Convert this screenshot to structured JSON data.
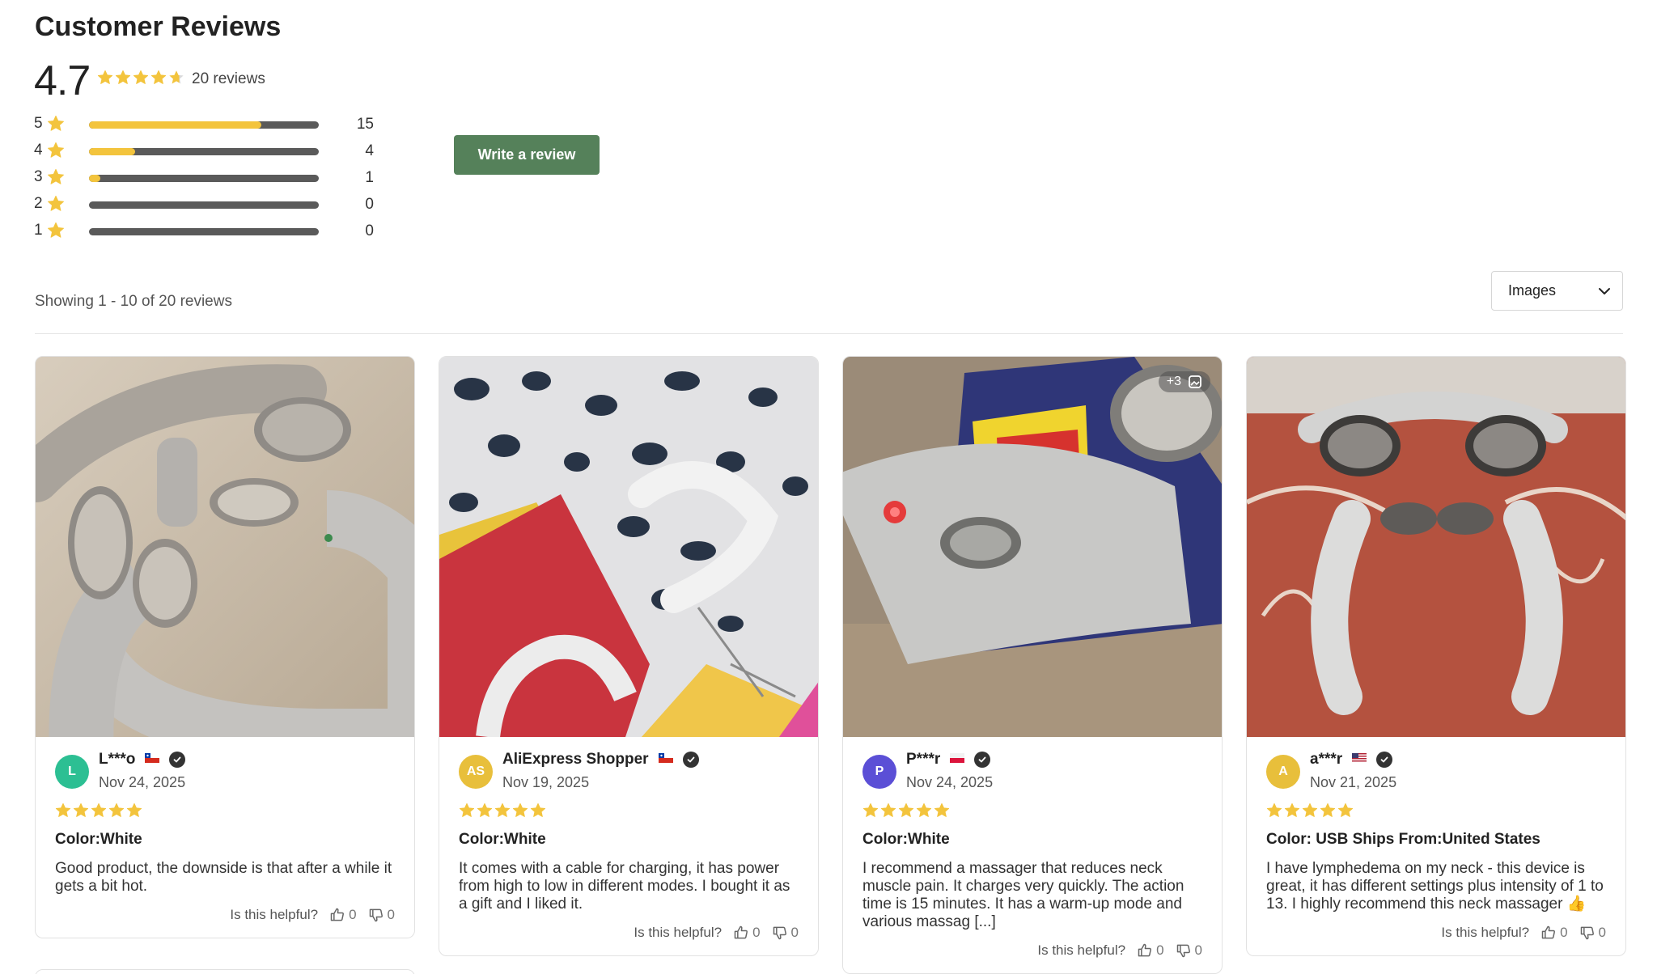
{
  "header": {
    "title": "Customer Reviews",
    "average": "4.7",
    "average_rating": 4.7,
    "total_label": "20 reviews"
  },
  "distribution": [
    {
      "level": "5",
      "count": "15",
      "fraction": 0.75
    },
    {
      "level": "4",
      "count": "4",
      "fraction": 0.2
    },
    {
      "level": "3",
      "count": "1",
      "fraction": 0.05
    },
    {
      "level": "2",
      "count": "0",
      "fraction": 0
    },
    {
      "level": "1",
      "count": "0",
      "fraction": 0
    }
  ],
  "write_review_label": "Write a review",
  "showing_label": "Showing 1 - 10 of 20 reviews",
  "filter": {
    "selected": "Images"
  },
  "colors": {
    "star": "#f3c43d",
    "button": "#55815a",
    "bar_track": "#5a5a5a"
  },
  "reviews": [
    {
      "initials": "L",
      "avatar_color": "#2cbf93",
      "name": "L***o",
      "flag": "Chile",
      "date": "Nov 24, 2025",
      "rating": 5,
      "variant": "Color:White",
      "text": "Good product, the downside is that after a while it gets a bit hot.",
      "helpful_label": "Is this helpful?",
      "up": "0",
      "down": "0",
      "photo": "neck-massager-on-tile-floor"
    },
    {
      "initials": "AS",
      "avatar_color": "#e8bf3b",
      "name": "AliExpress Shopper",
      "flag": "Chile",
      "date": "Nov 19, 2025",
      "rating": 5,
      "variant": "Color:White",
      "text": "It comes with a cable for charging, it has power from high to low in different modes. I bought it as a gift and I liked it.",
      "helpful_label": "Is this helpful?",
      "up": "0",
      "down": "0",
      "photo": "neck-massager-on-leopard-pillow"
    },
    {
      "initials": "P",
      "avatar_color": "#5b4fd6",
      "name": "P***r",
      "flag": "Poland",
      "date": "Nov 24, 2025",
      "rating": 5,
      "variant": "Color:White",
      "text": "I recommend a massager that reduces neck muscle pain. It charges very quickly. The action time is 15 minutes. It has a warm-up mode and various massag [...]",
      "helpful_label": "Is this helpful?",
      "up": "0",
      "down": "0",
      "more_images": "+3",
      "photo": "neck-massager-closeup"
    },
    {
      "initials": "A",
      "avatar_color": "#e8bf3b",
      "name": "a***r",
      "flag": "United States",
      "date": "Nov 21, 2025",
      "rating": 5,
      "variant": "Color: USB Ships From:United States",
      "text": "I have lymphedema on my neck - this device is great, it has different settings plus intensity of 1 to 13. I highly recommend this neck massager 👍",
      "helpful_label": "Is this helpful?",
      "up": "0",
      "down": "0",
      "photo": "neck-massager-on-red-cushion"
    }
  ]
}
